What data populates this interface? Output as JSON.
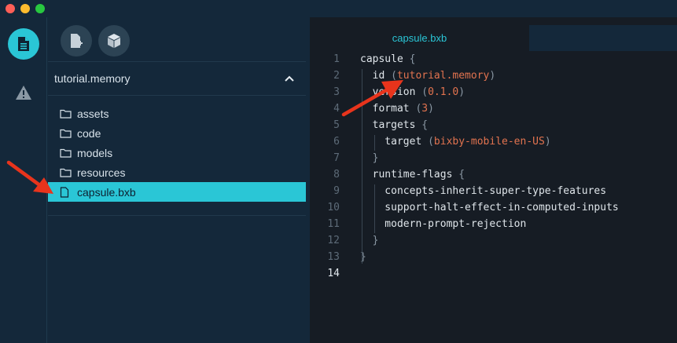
{
  "window": {
    "controls": [
      "close",
      "minimize",
      "maximize"
    ]
  },
  "activity_bar": {
    "items": [
      {
        "name": "files",
        "icon": "document-icon",
        "active": true
      },
      {
        "name": "warnings",
        "icon": "warning-icon",
        "active": false
      }
    ]
  },
  "sidebar": {
    "toolbar": [
      {
        "icon": "new-file-icon"
      },
      {
        "icon": "cube-icon"
      }
    ],
    "project": "tutorial.memory",
    "items": [
      {
        "label": "assets",
        "type": "folder"
      },
      {
        "label": "code",
        "type": "folder"
      },
      {
        "label": "models",
        "type": "folder"
      },
      {
        "label": "resources",
        "type": "folder"
      },
      {
        "label": "capsule.bxb",
        "type": "file",
        "selected": true
      }
    ]
  },
  "editor": {
    "tab": "capsule.bxb",
    "current_line": 14,
    "lines": [
      {
        "n": "1",
        "t": [
          [
            "k",
            "capsule"
          ],
          [
            "p",
            " {"
          ]
        ]
      },
      {
        "n": "2",
        "t": [
          [
            "k",
            "  id "
          ],
          [
            "p",
            "("
          ],
          [
            "s",
            "tutorial.memory"
          ],
          [
            "p",
            ")"
          ]
        ]
      },
      {
        "n": "3",
        "t": [
          [
            "k",
            "  version "
          ],
          [
            "p",
            "("
          ],
          [
            "s",
            "0.1.0"
          ],
          [
            "p",
            ")"
          ]
        ]
      },
      {
        "n": "4",
        "t": [
          [
            "k",
            "  format "
          ],
          [
            "p",
            "("
          ],
          [
            "s",
            "3"
          ],
          [
            "p",
            ")"
          ]
        ]
      },
      {
        "n": "5",
        "t": [
          [
            "k",
            "  targets"
          ],
          [
            "p",
            " {"
          ]
        ]
      },
      {
        "n": "6",
        "t": [
          [
            "k",
            "    target "
          ],
          [
            "p",
            "("
          ],
          [
            "s",
            "bixby-mobile-en-US"
          ],
          [
            "p",
            ")"
          ]
        ]
      },
      {
        "n": "7",
        "t": [
          [
            "p",
            "  }"
          ]
        ]
      },
      {
        "n": "8",
        "t": [
          [
            "k",
            "  runtime-flags"
          ],
          [
            "p",
            " {"
          ]
        ]
      },
      {
        "n": "9",
        "t": [
          [
            "k",
            "    concepts-inherit-super-type-features"
          ]
        ]
      },
      {
        "n": "10",
        "t": [
          [
            "k",
            "    support-halt-effect-in-computed-inputs"
          ]
        ]
      },
      {
        "n": "11",
        "t": [
          [
            "k",
            "    modern-prompt-rejection"
          ]
        ]
      },
      {
        "n": "12",
        "t": [
          [
            "p",
            "  }"
          ]
        ]
      },
      {
        "n": "13",
        "t": [
          [
            "p",
            "}"
          ]
        ]
      },
      {
        "n": "14",
        "t": []
      }
    ]
  },
  "colors": {
    "accent": "#2ac6d6",
    "string": "#e2734f",
    "annotation_arrow": "#e8341c"
  }
}
